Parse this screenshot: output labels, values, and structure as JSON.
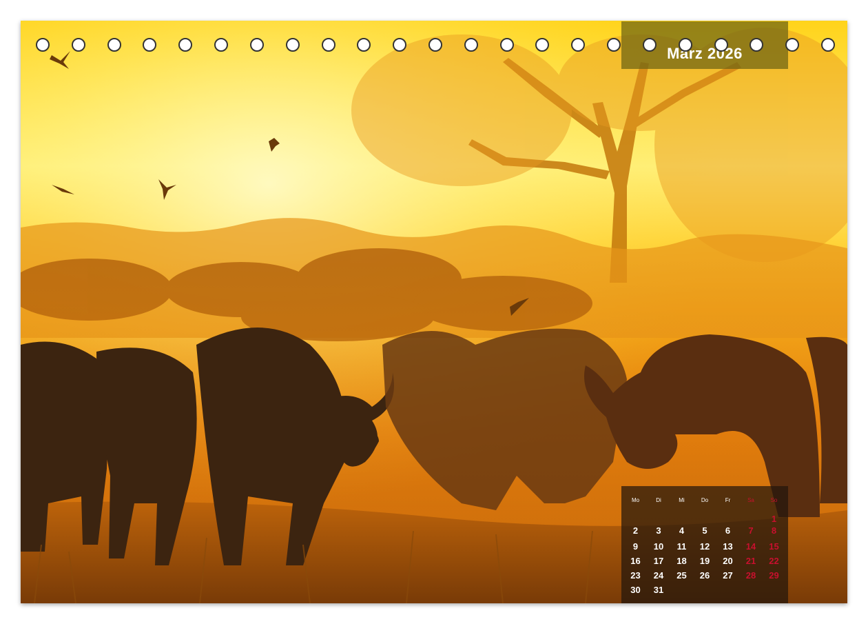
{
  "calendar": {
    "month_title": "März 2026",
    "weekday_headers": [
      "Mo",
      "Di",
      "Mi",
      "Do",
      "Fr",
      "Sa",
      "So"
    ],
    "weeks": [
      [
        "",
        "",
        "",
        "",
        "",
        "",
        "1"
      ],
      [
        "2",
        "3",
        "4",
        "5",
        "6",
        "7",
        "8"
      ],
      [
        "9",
        "10",
        "11",
        "12",
        "13",
        "14",
        "15"
      ],
      [
        "16",
        "17",
        "18",
        "19",
        "20",
        "21",
        "22"
      ],
      [
        "23",
        "24",
        "25",
        "26",
        "27",
        "28",
        "29"
      ],
      [
        "30",
        "31",
        "",
        "",
        "",
        "",
        ""
      ]
    ],
    "weekend_color": "#c8102e",
    "text_color": "#ffffff"
  },
  "binding": {
    "hole_count": 23
  },
  "photo": {
    "subject": "cape-buffalo-herd-at-sunset",
    "palette": [
      "#ffe54a",
      "#f5a10c",
      "#c8650a",
      "#3a1e0a"
    ]
  }
}
